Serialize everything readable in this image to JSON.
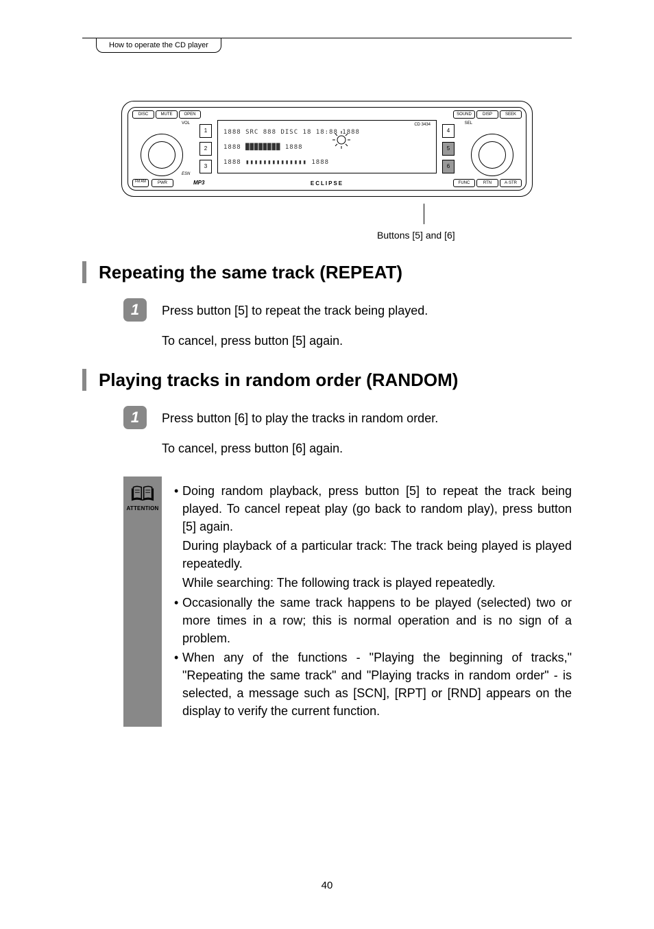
{
  "header": {
    "tab": "How to operate the CD player"
  },
  "device": {
    "model": "CD 3434",
    "logo": "ECLIPSE",
    "mp3": "MP3",
    "buttons_top_left": [
      "DISC",
      "MUTE",
      "OPEN"
    ],
    "buttons_top_right": [
      "SOUND",
      "DISP",
      "SEEK"
    ],
    "buttons_bottom_left": [
      "FM AM",
      "PWR"
    ],
    "buttons_bottom_right": [
      "FUNC",
      "RTN",
      "A·STR"
    ],
    "vol_label": "VOL",
    "sel_label": "SEL",
    "esn_label": "ESN",
    "num_left": [
      "1",
      "2",
      "3"
    ],
    "num_right": [
      "4",
      "5",
      "6"
    ],
    "lcd": {
      "row1": "1888  SRC 888 DISC 18  18:88        1888",
      "row2": "1888  ████████              1888",
      "row3": "1888  ▮▮▮▮▮▮▮▮▮▮▮▮▮▮        1888"
    }
  },
  "caption": "Buttons [5] and [6]",
  "section1": {
    "title": "Repeating the same track (REPEAT)",
    "step_num": "1",
    "step_text": "Press button [5] to repeat the track being played.",
    "step_sub": "To cancel, press button [5] again."
  },
  "section2": {
    "title": "Playing tracks in random order (RANDOM)",
    "step_num": "1",
    "step_text": "Press button [6] to play the tracks in random order.",
    "step_sub": "To cancel, press button [6] again."
  },
  "attention": {
    "label": "ATTENTION",
    "bullets": [
      {
        "main": "Doing random playback, press button [5] to repeat the track being played. To cancel repeat play (go back to random play), press button [5] again.",
        "subs": [
          "During playback of a particular track: The track being played is played repeatedly.",
          "While searching: The following track is played repeatedly."
        ]
      },
      {
        "main": "Occasionally the same track happens to be played (selected) two or more times in a row; this is normal operation and is no sign of a problem.",
        "subs": []
      },
      {
        "main": "When any of the functions - \"Playing the beginning of tracks,\" \"Repeating the same track\" and \"Playing tracks in random order\" - is selected, a message such as [SCN], [RPT] or [RND] appears on the display to verify the current function.",
        "subs": []
      }
    ]
  },
  "page_number": "40"
}
